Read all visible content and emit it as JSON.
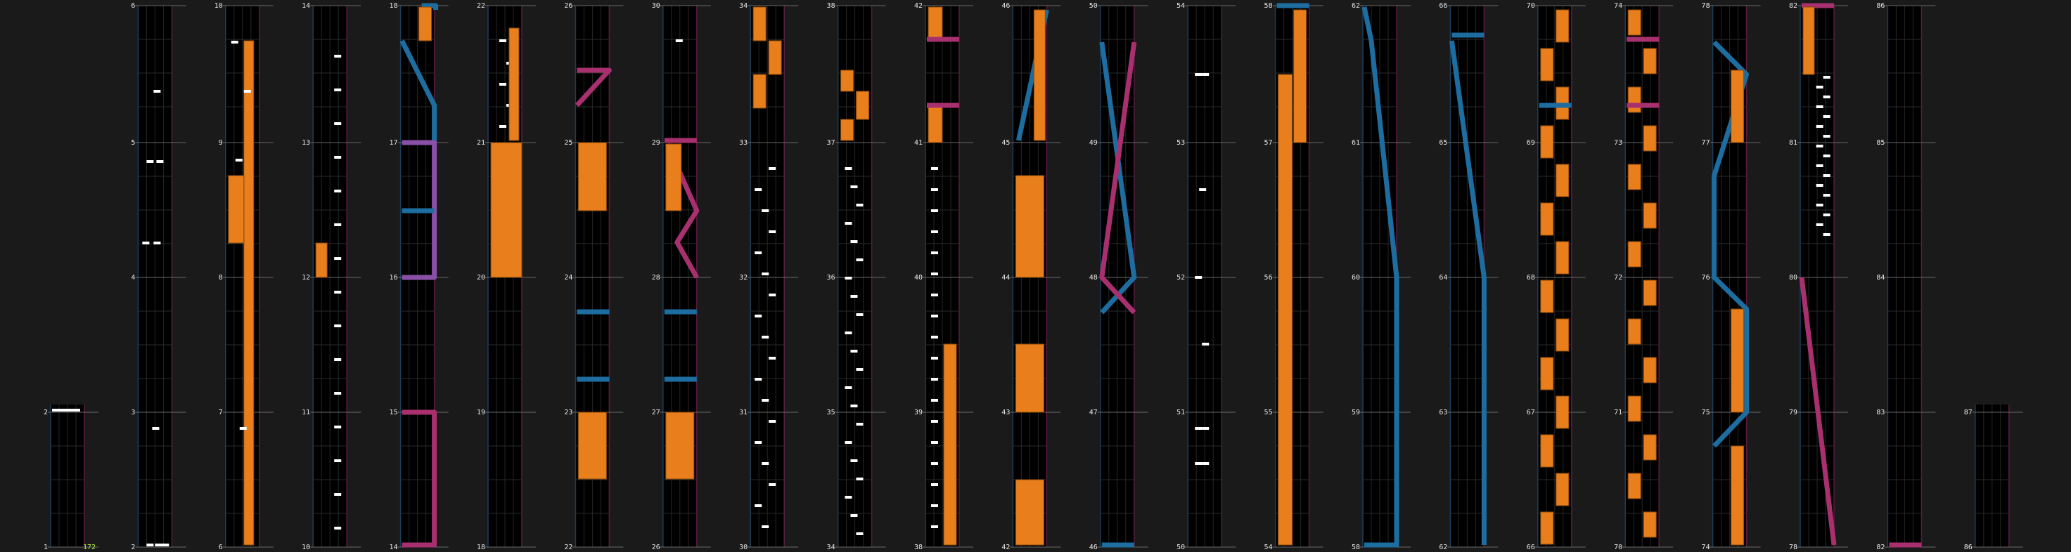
{
  "combo": "172",
  "colors": {
    "background": "#1a1a1a",
    "lane_fill": "#000000",
    "tap_note": "#ffffff",
    "hold_note": "#e87e1c",
    "slide_blue": "#1d6da0",
    "slide_pink": "#a8306f",
    "slide_purple": "#8a50a8",
    "combo_text": "#b6f23a"
  },
  "columns": [
    {
      "labels": [
        "2",
        "1"
      ]
    },
    {
      "labels": [
        "6",
        "5",
        "4",
        "3",
        "2"
      ]
    },
    {
      "labels": [
        "10",
        "9",
        "8",
        "7",
        "6"
      ]
    },
    {
      "labels": [
        "14",
        "13",
        "12",
        "11",
        "10"
      ]
    },
    {
      "labels": [
        "18",
        "17",
        "16",
        "15",
        "14"
      ]
    },
    {
      "labels": [
        "22",
        "21",
        "20",
        "19",
        "18"
      ]
    },
    {
      "labels": [
        "26",
        "25",
        "24",
        "23",
        "22"
      ]
    },
    {
      "labels": [
        "30",
        "29",
        "28",
        "27",
        "26"
      ]
    },
    {
      "labels": [
        "34",
        "33",
        "32",
        "31",
        "30"
      ]
    },
    {
      "labels": [
        "38",
        "37",
        "36",
        "35",
        "34"
      ]
    },
    {
      "labels": [
        "42",
        "41",
        "40",
        "39",
        "38"
      ]
    },
    {
      "labels": [
        "46",
        "45",
        "44",
        "43",
        "42"
      ]
    },
    {
      "labels": [
        "50",
        "49",
        "48",
        "47",
        "46"
      ]
    },
    {
      "labels": [
        "54",
        "53",
        "52",
        "51",
        "50"
      ]
    },
    {
      "labels": [
        "58",
        "57",
        "56",
        "55",
        "54"
      ]
    },
    {
      "labels": [
        "62",
        "61",
        "60",
        "59",
        "58"
      ]
    },
    {
      "labels": [
        "66",
        "65",
        "64",
        "63",
        "62"
      ]
    },
    {
      "labels": [
        "70",
        "69",
        "68",
        "67",
        "66"
      ]
    },
    {
      "labels": [
        "74",
        "73",
        "72",
        "71",
        "70"
      ]
    },
    {
      "labels": [
        "78",
        "77",
        "76",
        "75",
        "74"
      ]
    },
    {
      "labels": [
        "82",
        "81",
        "80",
        "79",
        "78"
      ]
    },
    {
      "labels": [
        "86",
        "85",
        "84",
        "83",
        "82"
      ]
    },
    {
      "labels": [
        "87",
        "86"
      ]
    }
  ]
}
